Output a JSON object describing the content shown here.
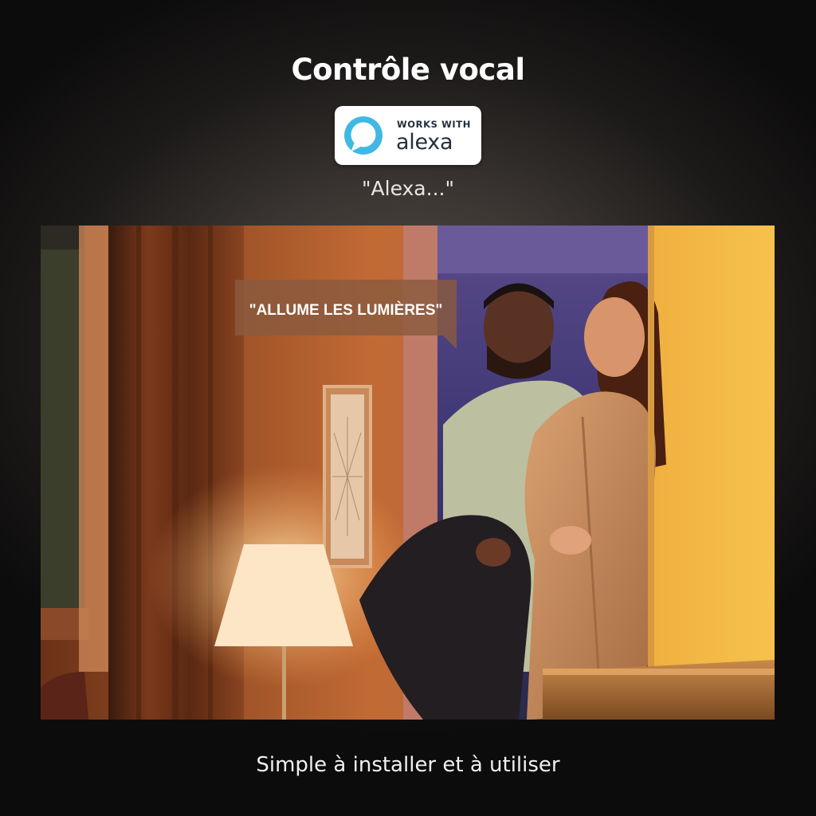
{
  "header": {
    "title": "Contrôle vocal"
  },
  "badge": {
    "works_with": "WORKS WITH",
    "brand": "alexa",
    "icon": "alexa-ring-icon",
    "ring_color": "#3fb9e3"
  },
  "wake_phrase": "\"Alexa...\"",
  "photo": {
    "speech_bubble": "\"ALLUME LES LUMIÈRES\""
  },
  "footer": {
    "tagline": "Simple à installer et à utiliser"
  }
}
